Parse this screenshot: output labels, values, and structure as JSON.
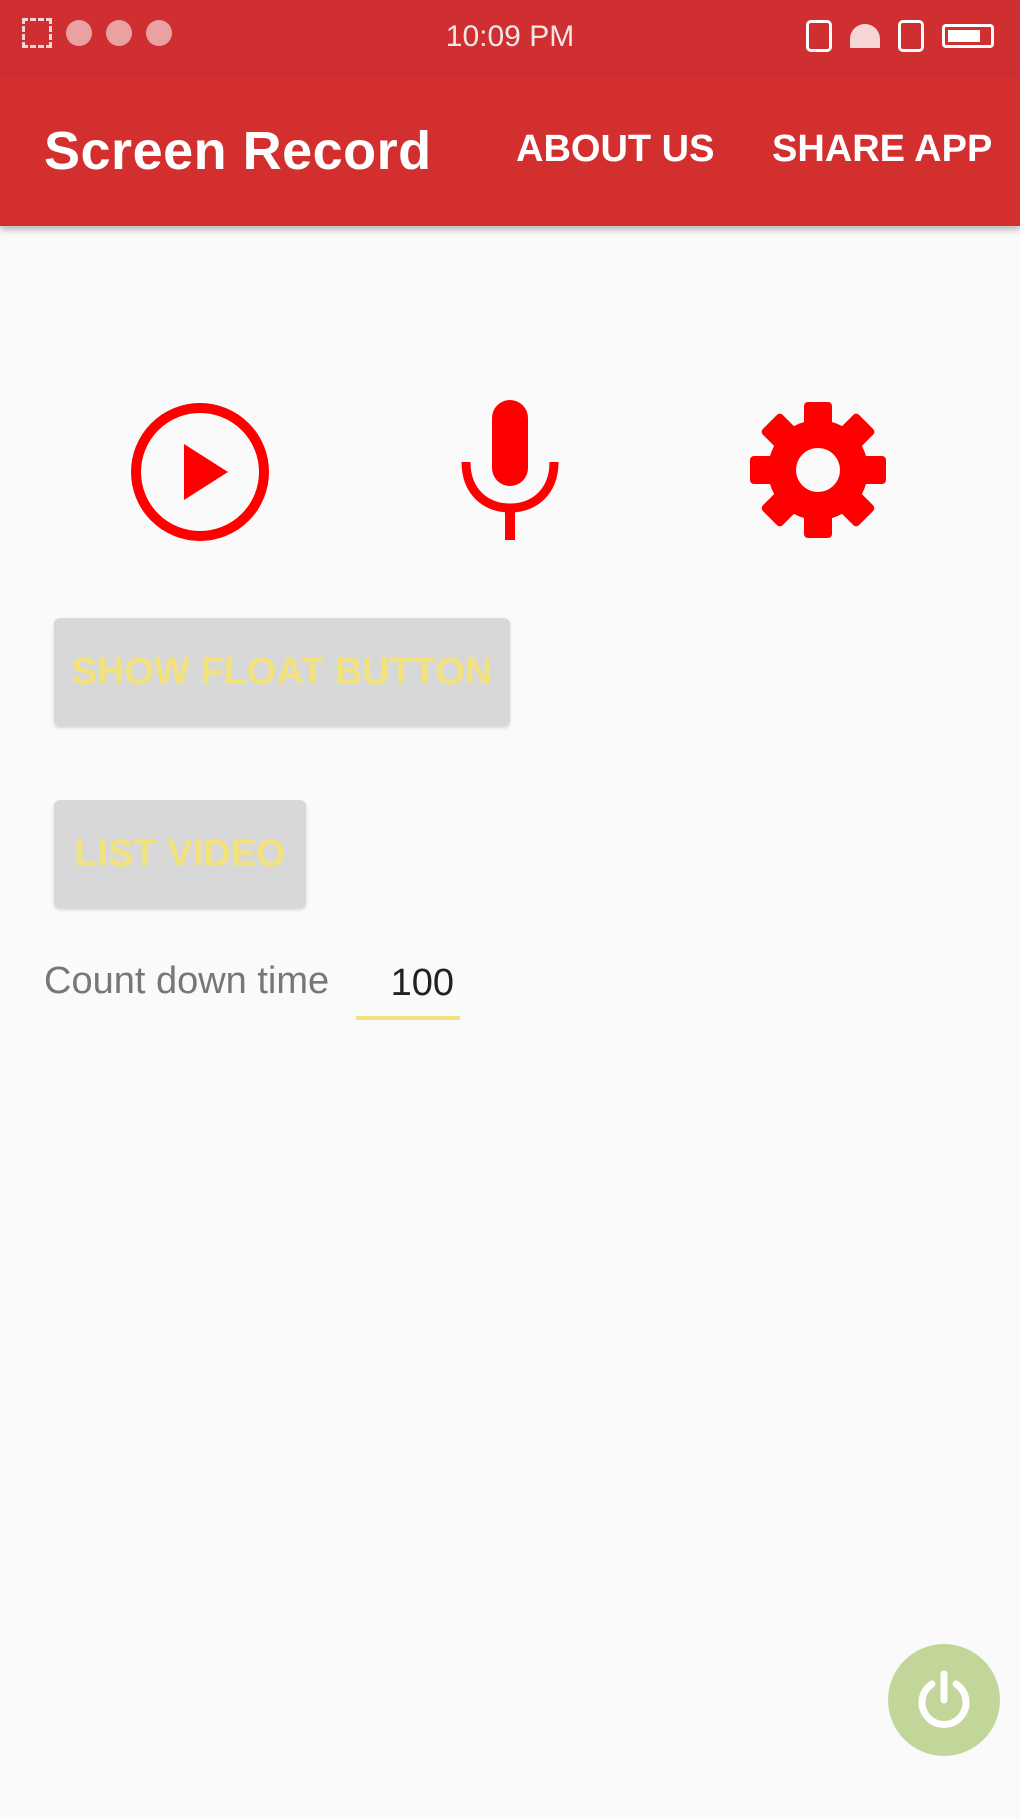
{
  "statusbar": {
    "time": "10:09 PM"
  },
  "appbar": {
    "title": "Screen Record",
    "menu": {
      "about": "ABOUT US",
      "share": "SHARE APP"
    }
  },
  "actions": {
    "play_icon": "play-circle-icon",
    "mic_icon": "microphone-icon",
    "settings_icon": "gear-icon"
  },
  "buttons": {
    "show_float": "SHOW FLOAT BUTTON",
    "list_video": "LIST VIDEO"
  },
  "countdown": {
    "label": "Count down time",
    "value": "100"
  },
  "fab": {
    "icon": "power-icon"
  },
  "colors": {
    "primary": "#d32f2f",
    "accent_red": "#ff0000",
    "button_bg": "#d8d8d8",
    "button_text": "#f2e27b",
    "fab": "#c2d69a"
  }
}
